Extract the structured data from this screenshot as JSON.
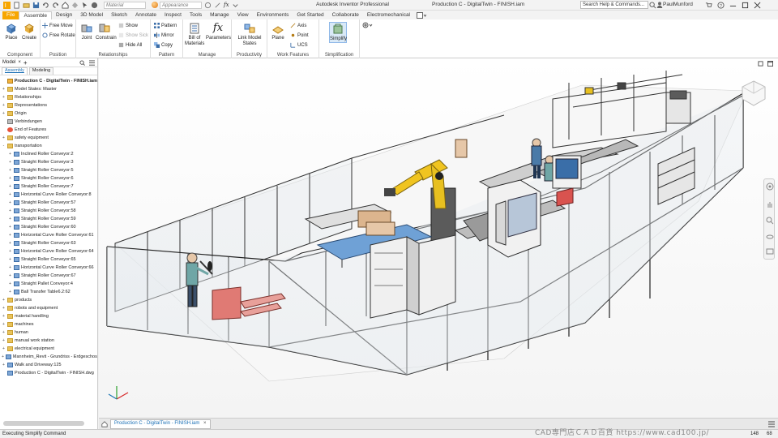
{
  "titlebar": {
    "material_value": "Material",
    "appearance_value": "Appearance",
    "app_title": "Autodesk Inventor Professional",
    "doc_title": "Production C - DigitalTwin - FINISH.iam",
    "search_placeholder": "Search Help & Commands...",
    "user_name": "PaulMunford"
  },
  "ribbon_tabs": [
    "File",
    "Assemble",
    "Design",
    "3D Model",
    "Sketch",
    "Annotate",
    "Inspect",
    "Tools",
    "Manage",
    "View",
    "Environments",
    "Get Started",
    "Collaborate",
    "Electromechanical"
  ],
  "ribbon": {
    "component": {
      "label": "Component",
      "place": "Place",
      "create": "Create"
    },
    "position": {
      "label": "Position",
      "free_move": "Free Move",
      "free_rotate": "Free Rotate"
    },
    "relationships": {
      "label": "Relationships",
      "joint": "Joint",
      "constrain": "Constrain",
      "show": "Show",
      "show_sick": "Show Sick",
      "hide_all": "Hide All"
    },
    "pattern": {
      "label": "Pattern",
      "pattern": "Pattern",
      "mirror": "Mirror",
      "copy": "Copy"
    },
    "manage": {
      "label": "Manage",
      "bom": "Bill of Materials",
      "parameters": "Parameters"
    },
    "productivity": {
      "label": "Productivity",
      "link_model_states": "Link Model States"
    },
    "work_features": {
      "label": "Work Features",
      "plane": "Plane",
      "axis": "Axis",
      "point": "Point",
      "ucs": "UCS"
    },
    "simplification": {
      "label": "Simplification",
      "simplify": "Simplify"
    }
  },
  "browser": {
    "title": "Model",
    "tabs": [
      "Assembly",
      "Modeling"
    ],
    "nodes": [
      {
        "label": "Production C - DigitalTwin - FINISH.iam",
        "level": 0,
        "icon": "asm",
        "exp": ""
      },
      {
        "label": "Model States: Master",
        "level": 1,
        "icon": "folder",
        "exp": "+"
      },
      {
        "label": "Relationships",
        "level": 1,
        "icon": "folder",
        "exp": "+"
      },
      {
        "label": "Representations",
        "level": 1,
        "icon": "folder",
        "exp": "+"
      },
      {
        "label": "Origin",
        "level": 1,
        "icon": "folder",
        "exp": "+"
      },
      {
        "label": "Verbindungen",
        "level": 1,
        "icon": "origin",
        "exp": ""
      },
      {
        "label": "End of Features",
        "level": 1,
        "icon": "stop",
        "exp": ""
      },
      {
        "label": "safety equipment",
        "level": 1,
        "icon": "folder",
        "exp": "+"
      },
      {
        "label": "transportation",
        "level": 1,
        "icon": "folder",
        "exp": "-"
      },
      {
        "label": "Inclined Roller Conveyor:2",
        "level": 2,
        "icon": "part",
        "exp": "+"
      },
      {
        "label": "Straight Roller Conveyor:3",
        "level": 2,
        "icon": "part",
        "exp": "+"
      },
      {
        "label": "Straight Roller Conveyor:5",
        "level": 2,
        "icon": "part",
        "exp": "+"
      },
      {
        "label": "Straight Roller Conveyor:6",
        "level": 2,
        "icon": "part",
        "exp": "+"
      },
      {
        "label": "Straight Roller Conveyor:7",
        "level": 2,
        "icon": "part",
        "exp": "+"
      },
      {
        "label": "Horizontal Curve Roller Conveyor:8",
        "level": 2,
        "icon": "part",
        "exp": "+"
      },
      {
        "label": "Straight Roller Conveyor:57",
        "level": 2,
        "icon": "part",
        "exp": "+"
      },
      {
        "label": "Straight Roller Conveyor:58",
        "level": 2,
        "icon": "part",
        "exp": "+"
      },
      {
        "label": "Straight Roller Conveyor:59",
        "level": 2,
        "icon": "part",
        "exp": "+"
      },
      {
        "label": "Straight Roller Conveyor:60",
        "level": 2,
        "icon": "part",
        "exp": "+"
      },
      {
        "label": "Horizontal Curve Roller Conveyor:61",
        "level": 2,
        "icon": "part",
        "exp": "+"
      },
      {
        "label": "Straight Roller Conveyor:63",
        "level": 2,
        "icon": "part",
        "exp": "+"
      },
      {
        "label": "Horizontal Curve Roller Conveyor:64",
        "level": 2,
        "icon": "part",
        "exp": "+"
      },
      {
        "label": "Straight Roller Conveyor:65",
        "level": 2,
        "icon": "part",
        "exp": "+"
      },
      {
        "label": "Horizontal Curve Roller Conveyor:66",
        "level": 2,
        "icon": "part",
        "exp": "+"
      },
      {
        "label": "Straight Roller Conveyor:67",
        "level": 2,
        "icon": "part",
        "exp": "+"
      },
      {
        "label": "Straight Pallet Conveyor:4",
        "level": 2,
        "icon": "part",
        "exp": "+"
      },
      {
        "label": "Ball Transfer Table6.2:62",
        "level": 2,
        "icon": "part",
        "exp": "+"
      },
      {
        "label": "products",
        "level": 1,
        "icon": "folder",
        "exp": "+"
      },
      {
        "label": "robots and equipment",
        "level": 1,
        "icon": "folder",
        "exp": "+"
      },
      {
        "label": "material handling",
        "level": 1,
        "icon": "folder",
        "exp": "+"
      },
      {
        "label": "machines",
        "level": 1,
        "icon": "folder",
        "exp": "+"
      },
      {
        "label": "human",
        "level": 1,
        "icon": "folder",
        "exp": "+"
      },
      {
        "label": "manual work station",
        "level": 1,
        "icon": "folder",
        "exp": "+"
      },
      {
        "label": "electrical equipment",
        "level": 1,
        "icon": "folder",
        "exp": "+"
      },
      {
        "label": "Mannheim_Revit - Grundriss - Erdgeschoss",
        "level": 1,
        "icon": "part",
        "exp": "+"
      },
      {
        "label": "Walk and Driveway:125",
        "level": 1,
        "icon": "part",
        "exp": "+"
      },
      {
        "label": "Production C - DigitalTwin - FINISH.dwg",
        "level": 1,
        "icon": "part",
        "exp": ""
      }
    ]
  },
  "doc_tab": "Production C - DigitalTwin - FINISH.iam",
  "status": {
    "text": "Executing Simplify Command",
    "num1": "148",
    "num2": "68"
  },
  "watermark": "CAD専門店ＣＡＤ百貨 https://www.cad100.jp/",
  "colors": {
    "file_tab": "#f7a600",
    "robot": "#e8c020",
    "accent": "#1a6fb5"
  }
}
